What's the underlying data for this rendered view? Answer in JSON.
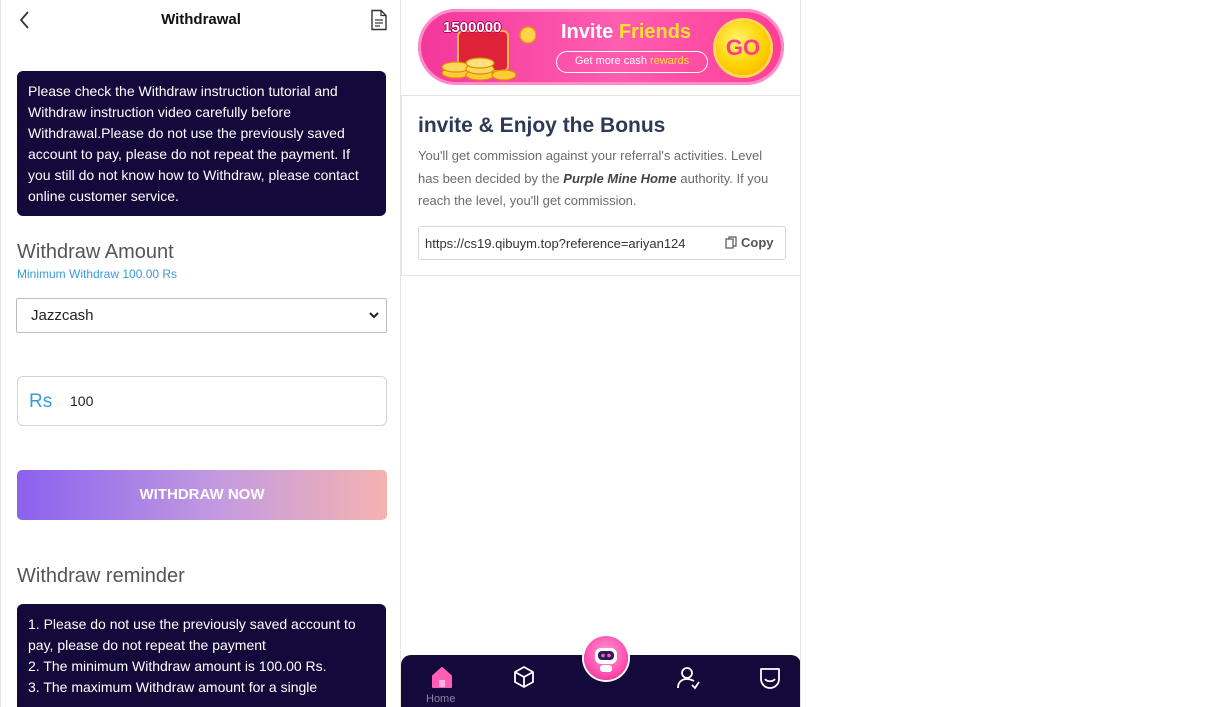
{
  "colors": {
    "accent_blue": "#3a9bd8",
    "notice_bg": "#13093a",
    "banner_pink": "#f3379b",
    "nav_bg": "#13093a"
  },
  "withdrawal": {
    "header": {
      "title": "Withdrawal",
      "back_icon": "chevron-left-icon",
      "doc_icon": "document-icon"
    },
    "notice": "Please check the Withdraw instruction tutorial and Withdraw instruction video carefully before Withdrawal.Please do not use the previously saved account to pay, please do not repeat the payment. If you still do not know how to Withdraw, please contact online customer service.",
    "amount_section": {
      "title": "Withdraw Amount",
      "minimum": "Minimum Withdraw 100.00 Rs"
    },
    "method_select": {
      "selected": "Jazzcash"
    },
    "amount_input": {
      "prefix": "Rs",
      "value": "100"
    },
    "submit_label": "WITHDRAW NOW",
    "reminder": {
      "title": "Withdraw reminder",
      "items": [
        "1. Please do not use the previously saved account to pay, please do not repeat the payment",
        "2. The minimum Withdraw amount is 100.00 Rs.",
        "3. The maximum Withdraw amount for a single"
      ]
    }
  },
  "invite": {
    "banner": {
      "amount": "1500000",
      "title_part1": "Invite",
      "title_part2": "Friends",
      "pill_part1": "Get more cash",
      "pill_part2": "rewards",
      "go": "GO"
    },
    "card": {
      "title": "invite & Enjoy the Bonus",
      "desc_part1": "You'll get commission against your referral's activities. Level has been decided by the",
      "brand": "Purple Mine Home",
      "desc_part2": "authority. If you reach the level, you'll get commission.",
      "link": "https://cs19.qibuym.top?reference=ariyan124",
      "copy_label": "Copy"
    },
    "bottom_nav": {
      "items": [
        {
          "icon": "home-icon",
          "label": "Home"
        },
        {
          "icon": "cube-icon"
        },
        {
          "icon": "robot-icon"
        },
        {
          "icon": "user-add-icon"
        },
        {
          "icon": "smile-icon"
        }
      ]
    }
  }
}
